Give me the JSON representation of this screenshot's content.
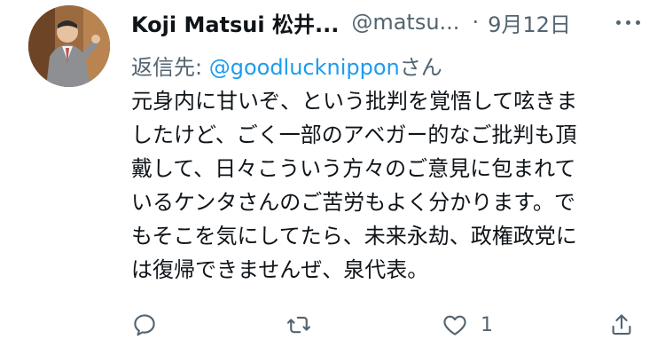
{
  "tweet": {
    "display_name": "Koji Matsui 松井...",
    "handle": "@matsu...",
    "separator": "·",
    "date": "9月12日",
    "reply_prefix": "返信先: ",
    "reply_mention": "@goodlucknippon",
    "reply_suffix": "さん",
    "body_lines": [
      "元身内に甘いぞ、という批判を覚悟して呟きま",
      "したけど、ごく一部のアベガー的なご批判も頂",
      "戴して、日々こういう方々のご意見に包まれて",
      "いるケンタさんのご苦労もよく分かります。で",
      "もそこを気にしてたら、未来永劫、政権政党に",
      "は復帰できませんぜ、泉代表。"
    ],
    "like_count": "1"
  },
  "icons": {
    "more": "more-horizontal-icon",
    "reply": "reply-icon",
    "retweet": "retweet-icon",
    "like": "heart-icon",
    "share": "share-icon"
  },
  "colors": {
    "text": "#0f1419",
    "muted": "#536471",
    "link": "#1d9bf0"
  }
}
